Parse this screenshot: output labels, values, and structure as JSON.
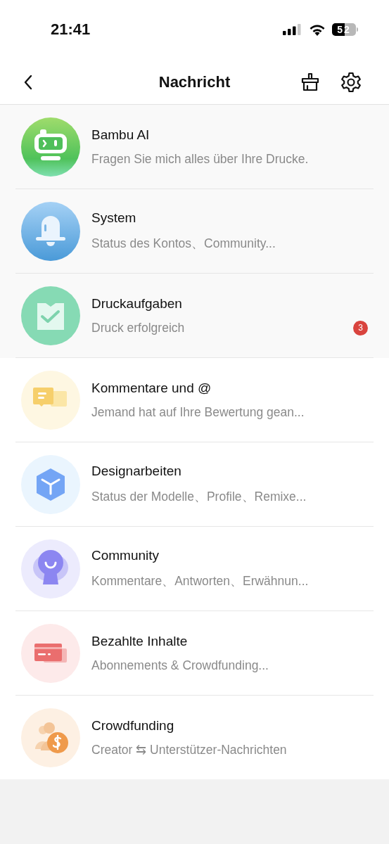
{
  "status_bar": {
    "time": "21:41",
    "battery": "52"
  },
  "header": {
    "title": "Nachricht"
  },
  "pinned_messages": [
    {
      "kind": "robot",
      "title": "Bambu AI",
      "subtitle": "Fragen Sie mich alles über Ihre Drucke."
    },
    {
      "kind": "bell",
      "title": "System",
      "subtitle": "Status des Kontos、Community..."
    },
    {
      "kind": "task",
      "title": "Druckaufgaben",
      "subtitle": "Druck erfolgreich",
      "badge": "3"
    }
  ],
  "messages": [
    {
      "kind": "comment",
      "title": "Kommentare und @",
      "subtitle": "Jemand hat auf Ihre Bewertung gean..."
    },
    {
      "kind": "cube",
      "title": "Designarbeiten",
      "subtitle": "Status der Modelle、Profile、Remixe..."
    },
    {
      "kind": "community",
      "title": "Community",
      "subtitle": "Kommentare、Antworten、Erwähnun..."
    },
    {
      "kind": "card",
      "title": "Bezahlte Inhalte",
      "subtitle": "Abonnements & Crowdfunding..."
    },
    {
      "kind": "crowdfunding",
      "title": "Crowdfunding",
      "subtitle": "Creator ⇆ Unterstützer-Nachrichten"
    }
  ]
}
